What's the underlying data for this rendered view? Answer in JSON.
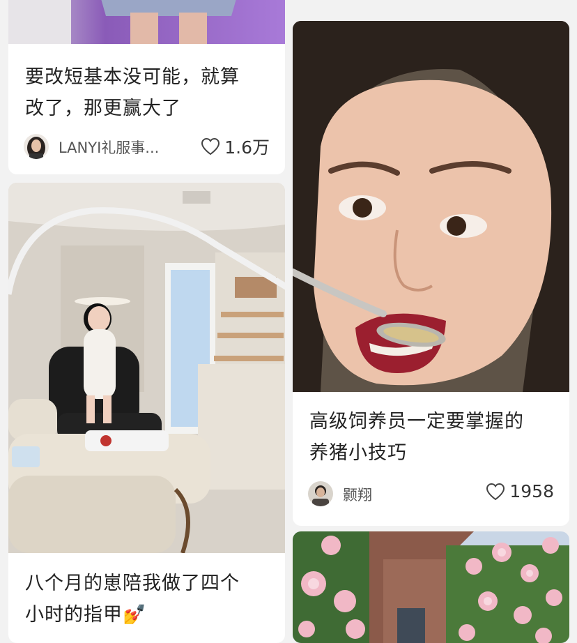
{
  "feed": {
    "card1": {
      "title_line1": "要改短基本没可能，就算",
      "title_line2": "改了，那更赢大了",
      "author": "LANYI礼服事...",
      "likes": "1.6万",
      "image_icon": "stage-dress-photo",
      "avatar_icon": "woman-avatar"
    },
    "card2": {
      "title_line1": "八个月的崽陪我做了四个",
      "title_line2": "小时的指甲",
      "emoji": "💅",
      "image_icon": "nail-salon-baby-photo"
    },
    "card3": {
      "title_line1": "高级饲养员一定要掌握的",
      "title_line2": "养猪小技巧",
      "author": "颢翔",
      "likes": "1958",
      "image_icon": "woman-spoon-photo",
      "avatar_icon": "man-avatar"
    },
    "card4": {
      "image_icon": "roses-house-photo"
    },
    "icons": {
      "like": "heart-outline-icon"
    }
  }
}
